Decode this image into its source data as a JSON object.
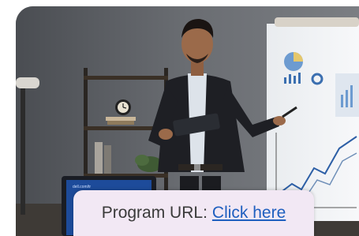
{
  "caption": {
    "label": "Program URL:",
    "link_text": "Click here"
  },
  "laptop": {
    "screen_text": "dell.com/tr"
  },
  "colors": {
    "caption_bg": "#f2e8f4",
    "link": "#1f5fbf",
    "wall": "#5a5d62"
  }
}
